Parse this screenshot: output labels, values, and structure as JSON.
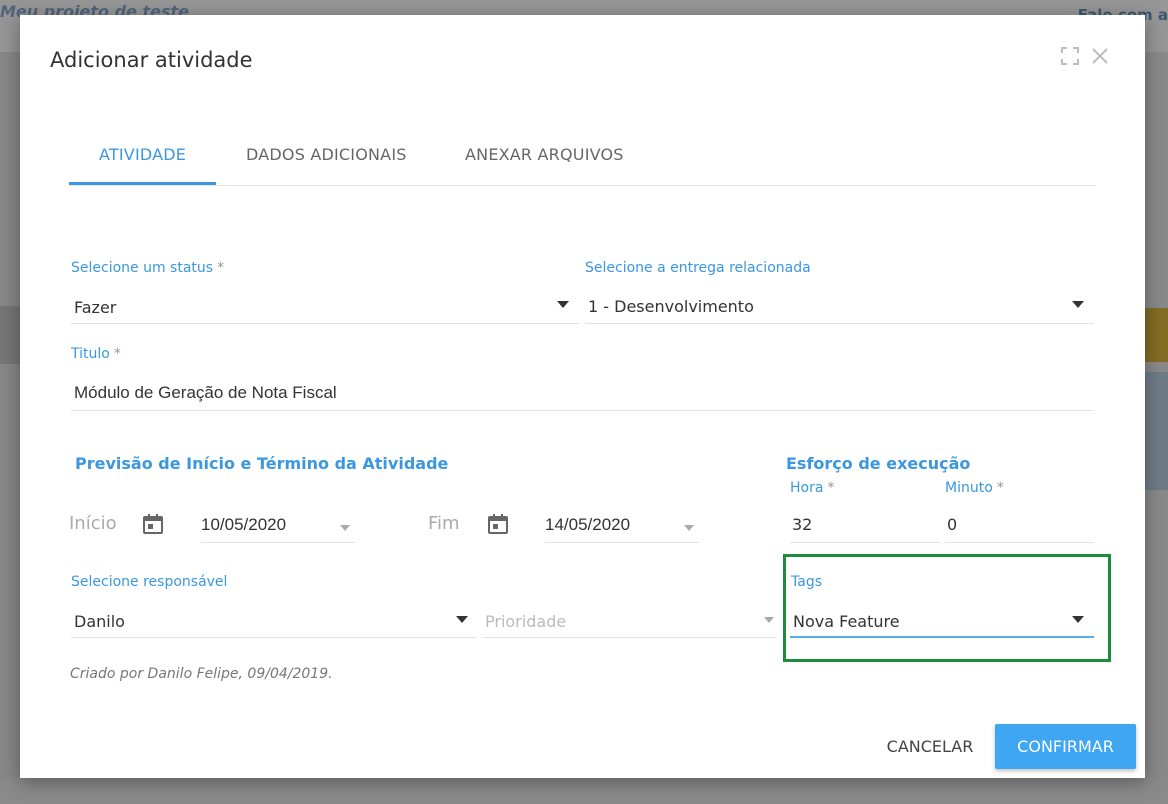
{
  "background": {
    "left_title": "Meu projeto de teste",
    "right_link": "Fale com a"
  },
  "modal": {
    "title": "Adicionar atividade",
    "maximize_icon": "maximize-icon",
    "close_icon": "close-icon"
  },
  "tabs": [
    {
      "label": "ATIVIDADE",
      "active": true
    },
    {
      "label": "DADOS ADICIONAIS",
      "active": false
    },
    {
      "label": "ANEXAR ARQUIVOS",
      "active": false
    }
  ],
  "form": {
    "status": {
      "label": "Selecione um status",
      "required": "*",
      "value": "Fazer"
    },
    "entrega": {
      "label": "Selecione a entrega relacionada",
      "value": "1 - Desenvolvimento"
    },
    "titulo": {
      "label": "Titulo",
      "required": "*",
      "value": "Módulo de Geração de Nota Fiscal"
    },
    "previsao": {
      "section_title": "Previsão de Início e Término da Atividade",
      "inicio_label": "Início",
      "inicio_value": "10/05/2020",
      "fim_label": "Fim",
      "fim_value": "14/05/2020"
    },
    "esforco": {
      "section_title": "Esforço de execução",
      "hora_label": "Hora",
      "hora_required": "*",
      "hora_value": "32",
      "minuto_label": "Minuto",
      "minuto_required": "*",
      "minuto_value": "0"
    },
    "responsavel": {
      "label": "Selecione responsável",
      "value": "Danilo"
    },
    "prioridade": {
      "placeholder": "Prioridade"
    },
    "tags": {
      "label": "Tags",
      "value": "Nova Feature"
    }
  },
  "footer": {
    "created_note": "Criado por Danilo Felipe, 09/04/2019.",
    "cancel_label": "CANCELAR",
    "confirm_label": "CONFIRMAR"
  },
  "colors": {
    "accent": "#3a97e0",
    "confirm": "#3ea6f2",
    "highlight": "#1e8a3c"
  }
}
